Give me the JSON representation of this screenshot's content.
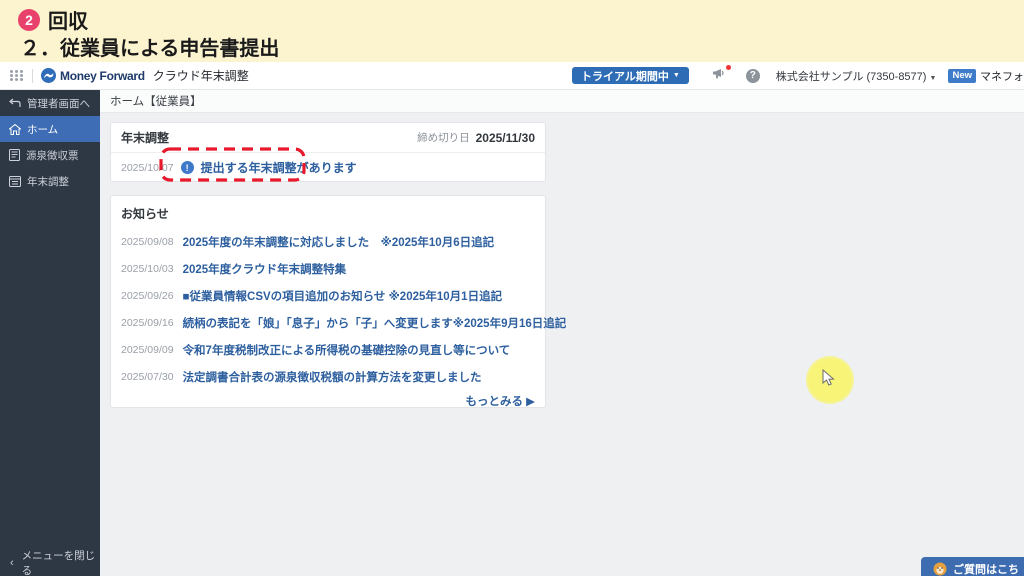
{
  "banner": {
    "step_number": "2",
    "step_label": "回収",
    "subtitle": "２．従業員による申告書提出"
  },
  "navbar": {
    "brand": "Money Forward",
    "product": "クラウド年末調整",
    "trial_button": "トライアル期間中",
    "trial_caret": "▼",
    "company": "株式会社サンプル (7350-8577)",
    "company_caret": "▼",
    "new_badge": "New",
    "partner_text": "マネフォ"
  },
  "sidebar": {
    "items": [
      {
        "label": "管理者画面へ",
        "icon": "switch-arrow-icon",
        "active": false
      },
      {
        "label": "ホーム",
        "icon": "home-icon",
        "active": true
      },
      {
        "label": "源泉徴収票",
        "icon": "withholding-slip-icon",
        "active": false
      },
      {
        "label": "年末調整",
        "icon": "nencho-form-icon",
        "active": false
      }
    ],
    "collapse_chevron": "‹",
    "collapse_label": "メニューを閉じる"
  },
  "breadcrumb": "ホーム【従業員】",
  "nencho_card": {
    "title": "年末調整",
    "deadline_label": "締め切り日",
    "deadline_value": "2025/11/30",
    "row_date": "2025/10/07",
    "info_glyph": "!",
    "link": "提出する年末調整があります"
  },
  "news_card": {
    "title": "お知らせ",
    "items": [
      {
        "date": "2025/09/08",
        "text": "2025年度の年末調整に対応しました　※2025年10月6日追記"
      },
      {
        "date": "2025/10/03",
        "text": "2025年度クラウド年末調整特集"
      },
      {
        "date": "2025/09/26",
        "text": "■従業員情報CSVの項目追加のお知らせ ※2025年10月1日追記"
      },
      {
        "date": "2025/09/16",
        "text": "続柄の表記を「娘」「息子」から「子」へ変更します※2025年9月16日追記"
      },
      {
        "date": "2025/09/09",
        "text": "令和7年度税制改正による所得税の基礎控除の見直し等について"
      },
      {
        "date": "2025/07/30",
        "text": "法定調書合計表の源泉徴収税額の計算方法を変更しました"
      }
    ],
    "more_link": "もっとみる ▶"
  },
  "help_button": {
    "label": "ご質問はこち"
  },
  "colors": {
    "banner_bg": "#fcf3cf",
    "step_badge": "#e8426c",
    "sidebar_bg": "#2e3744",
    "active_item": "#3e6db5",
    "primary_button": "#2e6cb5",
    "link_blue": "#2d5f9f",
    "dashed_highlight": "#e8192c",
    "cursor_highlight": "#f8f477"
  }
}
